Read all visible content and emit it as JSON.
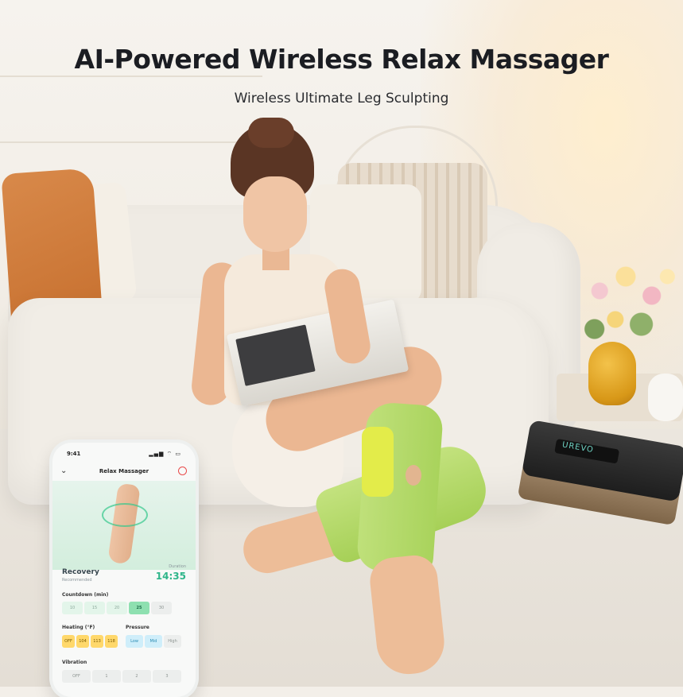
{
  "headline": {
    "title": "AI-Powered Wireless Relax Massager",
    "subtitle": "Wireless Ultimate Leg Sculpting"
  },
  "phone": {
    "status_time": "9:41",
    "status_icons": "▂▄▆ ⌔ ▭",
    "app_title": "Relax Massager",
    "mode_name": "Recovery",
    "mode_sub": "Recommended",
    "duration_label": "Duration",
    "duration_value": "14:35",
    "countdown_label": "Countdown (min)",
    "countdown_options": [
      "10",
      "15",
      "20",
      "25",
      "30"
    ],
    "countdown_selected": "25",
    "heating_label": "Heating (°F)",
    "heating_options": [
      "OFF",
      "104",
      "113",
      "118"
    ],
    "pressure_label": "Pressure",
    "pressure_options": [
      "Low",
      "Mid",
      "High"
    ],
    "vibration_label": "Vibration",
    "vibration_options": [
      "OFF",
      "1",
      "2",
      "3"
    ]
  },
  "treadmill": {
    "display_text": "UREVO"
  },
  "colors": {
    "accent_green": "#2fb58a",
    "massager_green": "#b5da6b",
    "pillow_orange": "#c7702f"
  }
}
